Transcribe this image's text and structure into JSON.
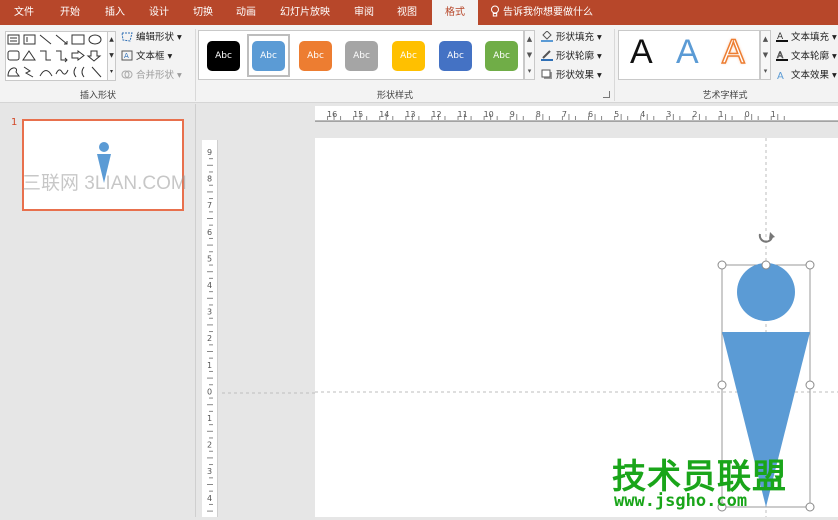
{
  "tabs": [
    "文件",
    "开始",
    "插入",
    "设计",
    "切换",
    "动画",
    "幻灯片放映",
    "审阅",
    "视图",
    "格式"
  ],
  "tell_me": "告诉我你想要做什么",
  "insert_shapes": {
    "edit_shape": "编辑形状",
    "text_box": "文本框",
    "merge_shapes": "合并形状",
    "group_label": "插入形状"
  },
  "shape_styles": {
    "swatch_text": "Abc",
    "swatches": [
      "#000000",
      "#5b9bd5",
      "#ed7d31",
      "#a5a5a5",
      "#ffc000",
      "#4472c4",
      "#70ad47"
    ],
    "fill": "形状填充",
    "outline": "形状轮廓",
    "effects": "形状效果",
    "group_label": "形状样式"
  },
  "wordart": {
    "letter": "A",
    "text_fill": "文本填充",
    "text_outline": "文本轮廓",
    "text_effects": "文本效果",
    "group_label": "艺术字样式"
  },
  "slide_panel": {
    "slide_number": "1"
  },
  "ruler": {
    "h_labels": [
      "16",
      "15",
      "14",
      "13",
      "12",
      "11",
      "10",
      "9",
      "8",
      "7",
      "6",
      "5",
      "4",
      "3",
      "2",
      "1",
      "0",
      "1"
    ],
    "v_labels": [
      "9",
      "8",
      "7",
      "6",
      "5",
      "4",
      "3",
      "2",
      "1",
      "0",
      "1",
      "2",
      "3",
      "4"
    ]
  },
  "watermarks": {
    "thumb": "三联网 3LIAN.COM",
    "brand": "技术员联盟",
    "url": "www.jsgho.com"
  },
  "colors": {
    "accent": "#b7472a",
    "shape_fill": "#5b9bd5"
  }
}
